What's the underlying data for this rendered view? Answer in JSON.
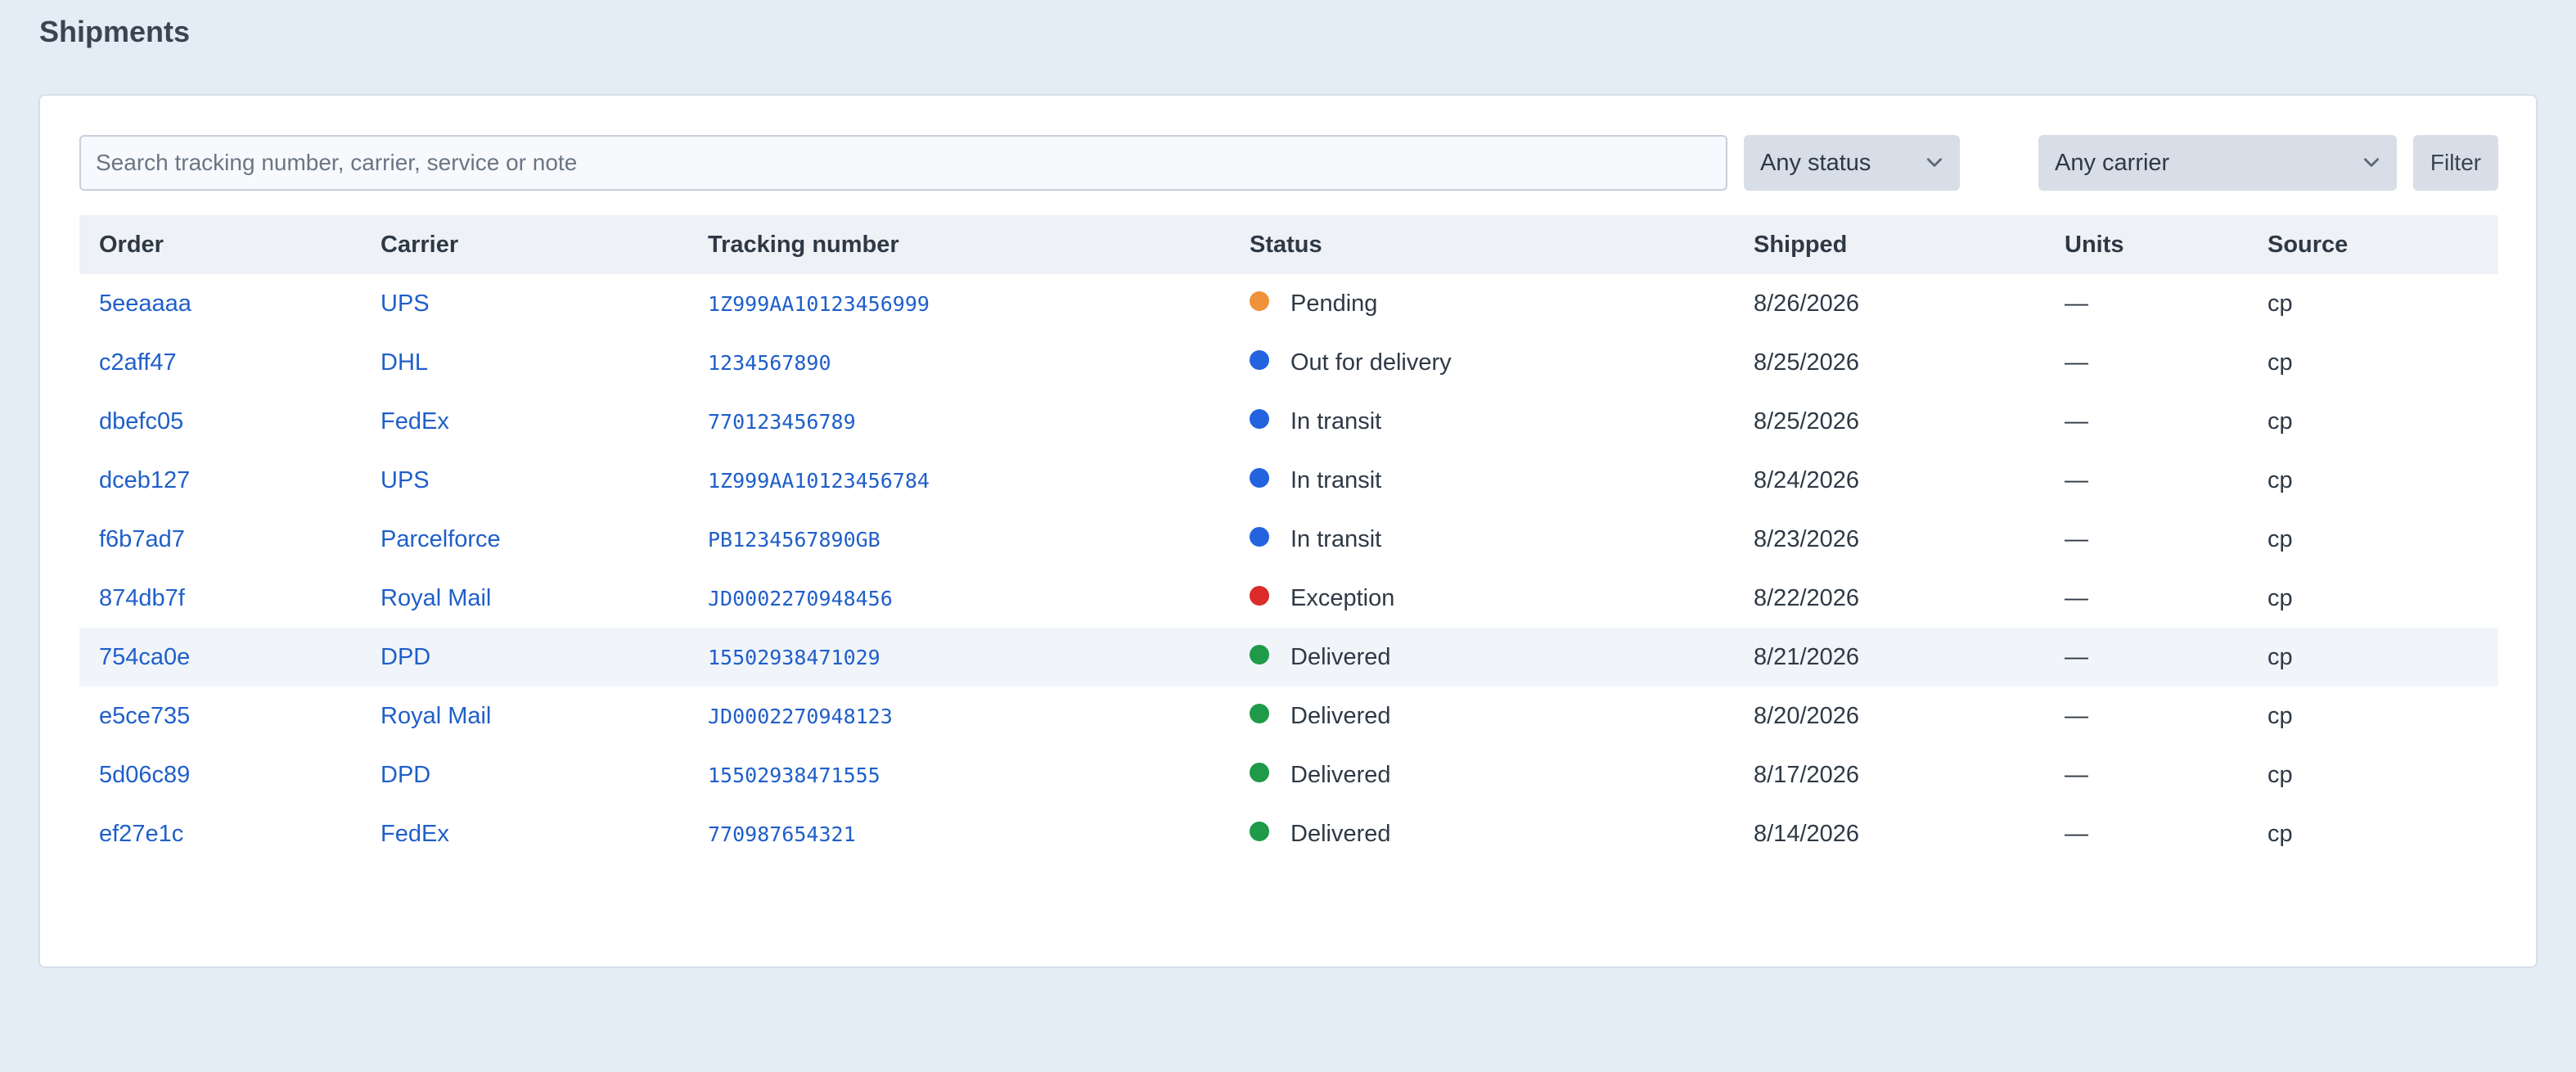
{
  "page": {
    "title": "Shipments"
  },
  "filters": {
    "search_placeholder": "Search tracking number, carrier, service or note",
    "search_value": "",
    "status_selected": "Any status",
    "carrier_selected": "Any carrier",
    "filter_label": "Filter"
  },
  "table": {
    "headers": [
      "Order",
      "Carrier",
      "Tracking number",
      "Status",
      "Shipped",
      "Units",
      "Source"
    ],
    "rows": [
      {
        "order": "5eeaaaa",
        "carrier": "UPS",
        "tracking": "1Z999AA10123456999",
        "status": "Pending",
        "status_color": "#f0923a",
        "shipped": "8/26/2026",
        "units": "—",
        "source": "cp"
      },
      {
        "order": "c2aff47",
        "carrier": "DHL",
        "tracking": "1234567890",
        "status": "Out for delivery",
        "status_color": "#2463e0",
        "shipped": "8/25/2026",
        "units": "—",
        "source": "cp"
      },
      {
        "order": "dbefc05",
        "carrier": "FedEx",
        "tracking": "770123456789",
        "status": "In transit",
        "status_color": "#2463e0",
        "shipped": "8/25/2026",
        "units": "—",
        "source": "cp"
      },
      {
        "order": "dceb127",
        "carrier": "UPS",
        "tracking": "1Z999AA10123456784",
        "status": "In transit",
        "status_color": "#2463e0",
        "shipped": "8/24/2026",
        "units": "—",
        "source": "cp"
      },
      {
        "order": "f6b7ad7",
        "carrier": "Parcelforce",
        "tracking": "PB1234567890GB",
        "status": "In transit",
        "status_color": "#2463e0",
        "shipped": "8/23/2026",
        "units": "—",
        "source": "cp"
      },
      {
        "order": "874db7f",
        "carrier": "Royal Mail",
        "tracking": "JD0002270948456",
        "status": "Exception",
        "status_color": "#dc2b2b",
        "shipped": "8/22/2026",
        "units": "—",
        "source": "cp"
      },
      {
        "order": "754ca0e",
        "carrier": "DPD",
        "tracking": "15502938471029",
        "status": "Delivered",
        "status_color": "#1e9a48",
        "shipped": "8/21/2026",
        "units": "—",
        "source": "cp"
      },
      {
        "order": "e5ce735",
        "carrier": "Royal Mail",
        "tracking": "JD0002270948123",
        "status": "Delivered",
        "status_color": "#1e9a48",
        "shipped": "8/20/2026",
        "units": "—",
        "source": "cp"
      },
      {
        "order": "5d06c89",
        "carrier": "DPD",
        "tracking": "15502938471555",
        "status": "Delivered",
        "status_color": "#1e9a48",
        "shipped": "8/17/2026",
        "units": "—",
        "source": "cp"
      },
      {
        "order": "ef27e1c",
        "carrier": "FedEx",
        "tracking": "770987654321",
        "status": "Delivered",
        "status_color": "#1e9a48",
        "shipped": "8/14/2026",
        "units": "—",
        "source": "cp"
      }
    ]
  },
  "icons": {
    "select_chevron": "chevron-down-icon"
  }
}
